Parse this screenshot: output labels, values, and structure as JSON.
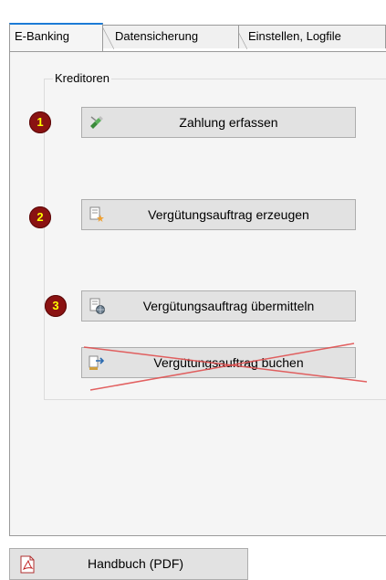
{
  "tabs": [
    {
      "label": "E-Banking",
      "active": true
    },
    {
      "label": "Datensicherung",
      "active": false
    },
    {
      "label": "Einstellen, Logfile",
      "active": false
    }
  ],
  "group": {
    "title": "Kreditoren"
  },
  "buttons": {
    "zahlung": {
      "label": "Zahlung erfassen",
      "icon": "hand-pen-icon"
    },
    "erzeugen": {
      "label": "Vergütungsauftrag erzeugen",
      "icon": "document-star-icon"
    },
    "uebermitteln": {
      "label": "Vergütungsauftrag übermitteln",
      "icon": "document-globe-icon"
    },
    "buchen": {
      "label": "Vergütungsauftrag buchen",
      "icon": "document-arrow-icon",
      "crossed_out": true
    }
  },
  "steps": [
    "1",
    "2",
    "3"
  ],
  "footer": {
    "handbuch": {
      "label": "Handbuch (PDF)",
      "icon": "pdf-icon"
    }
  },
  "colors": {
    "tab_accent": "#1c7bd6",
    "badge": "#8a1212",
    "badge_text": "#ffff00",
    "strike": "#e05050"
  }
}
